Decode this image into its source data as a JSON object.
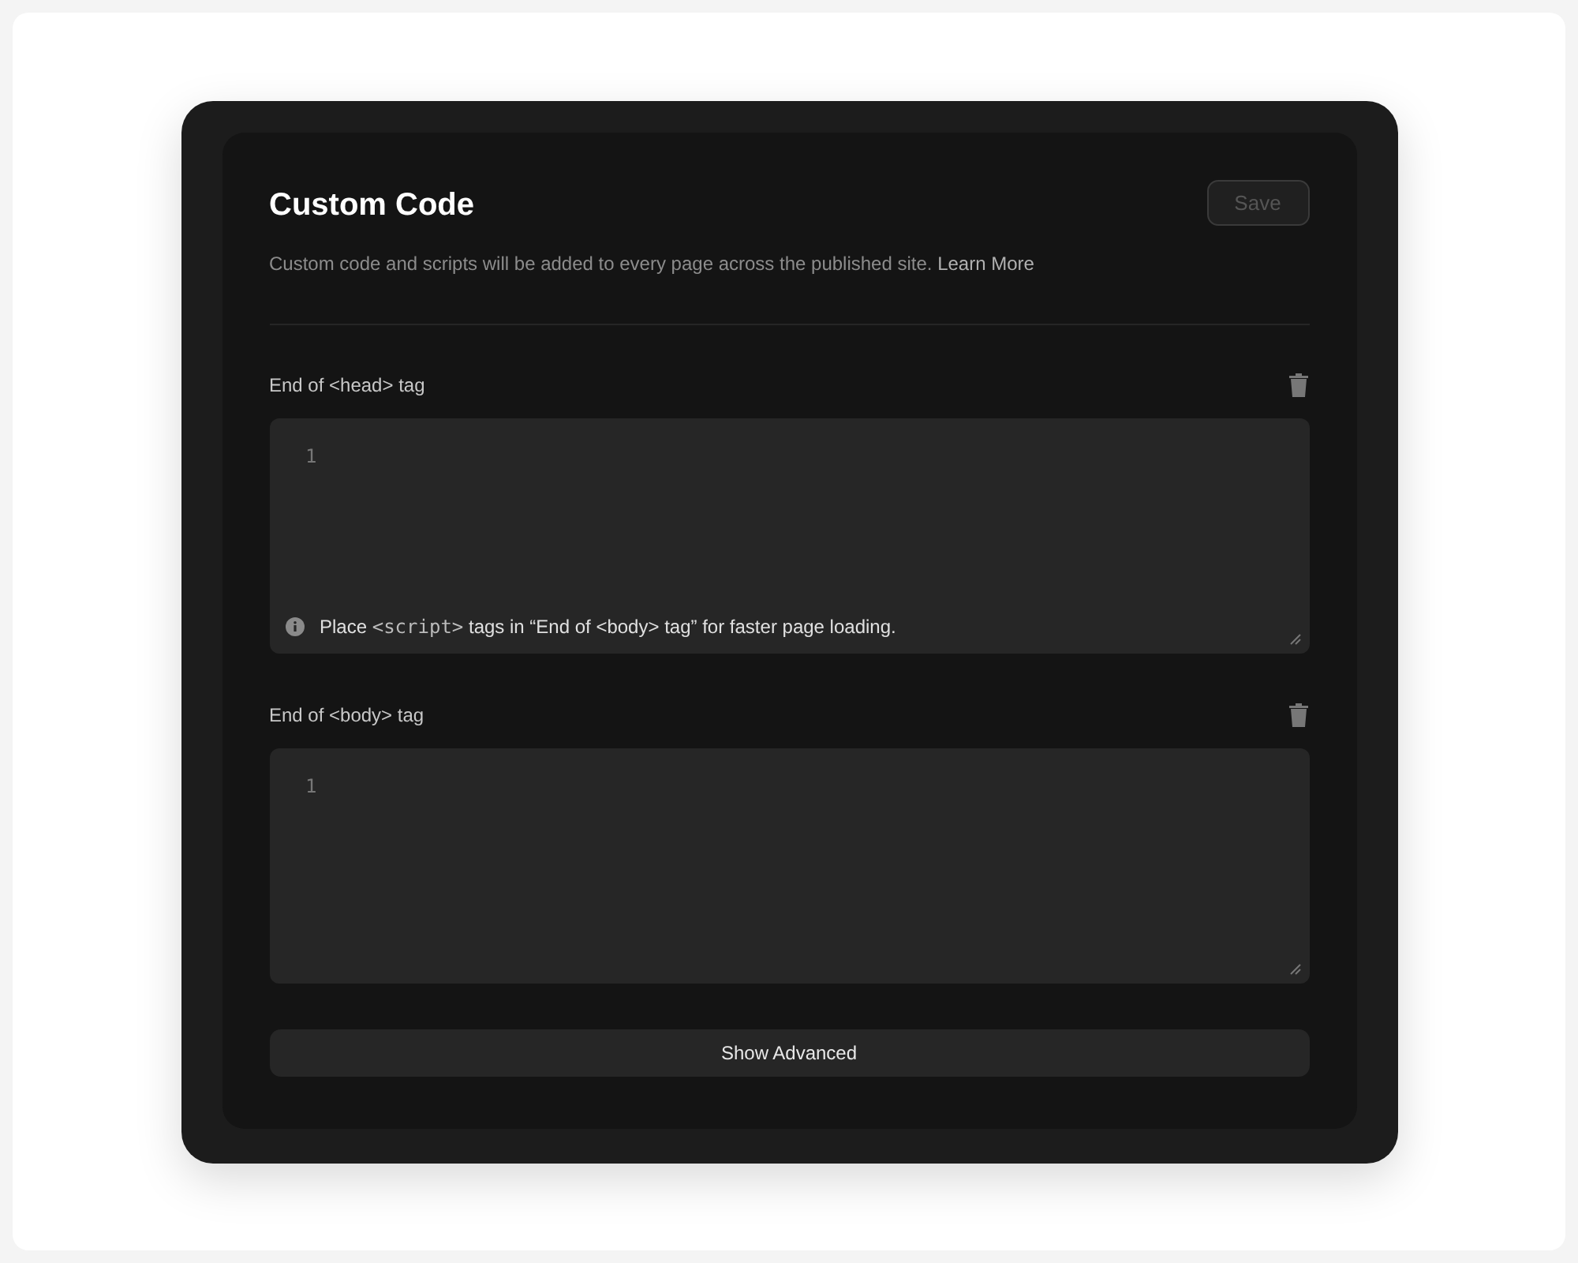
{
  "title": "Custom Code",
  "save_button": {
    "label": "Save",
    "disabled": true
  },
  "description": {
    "text": "Custom code and scripts will be added to every page across the published site.",
    "link": "Learn More"
  },
  "sections": [
    {
      "label": "End of <head> tag",
      "line_number": "1",
      "hint": {
        "before": "Place",
        "code": "<script>",
        "after": "tags in “End of <body> tag” for faster page loading."
      }
    },
    {
      "label": "End of <body> tag",
      "line_number": "1"
    }
  ],
  "advanced_button": "Show Advanced"
}
